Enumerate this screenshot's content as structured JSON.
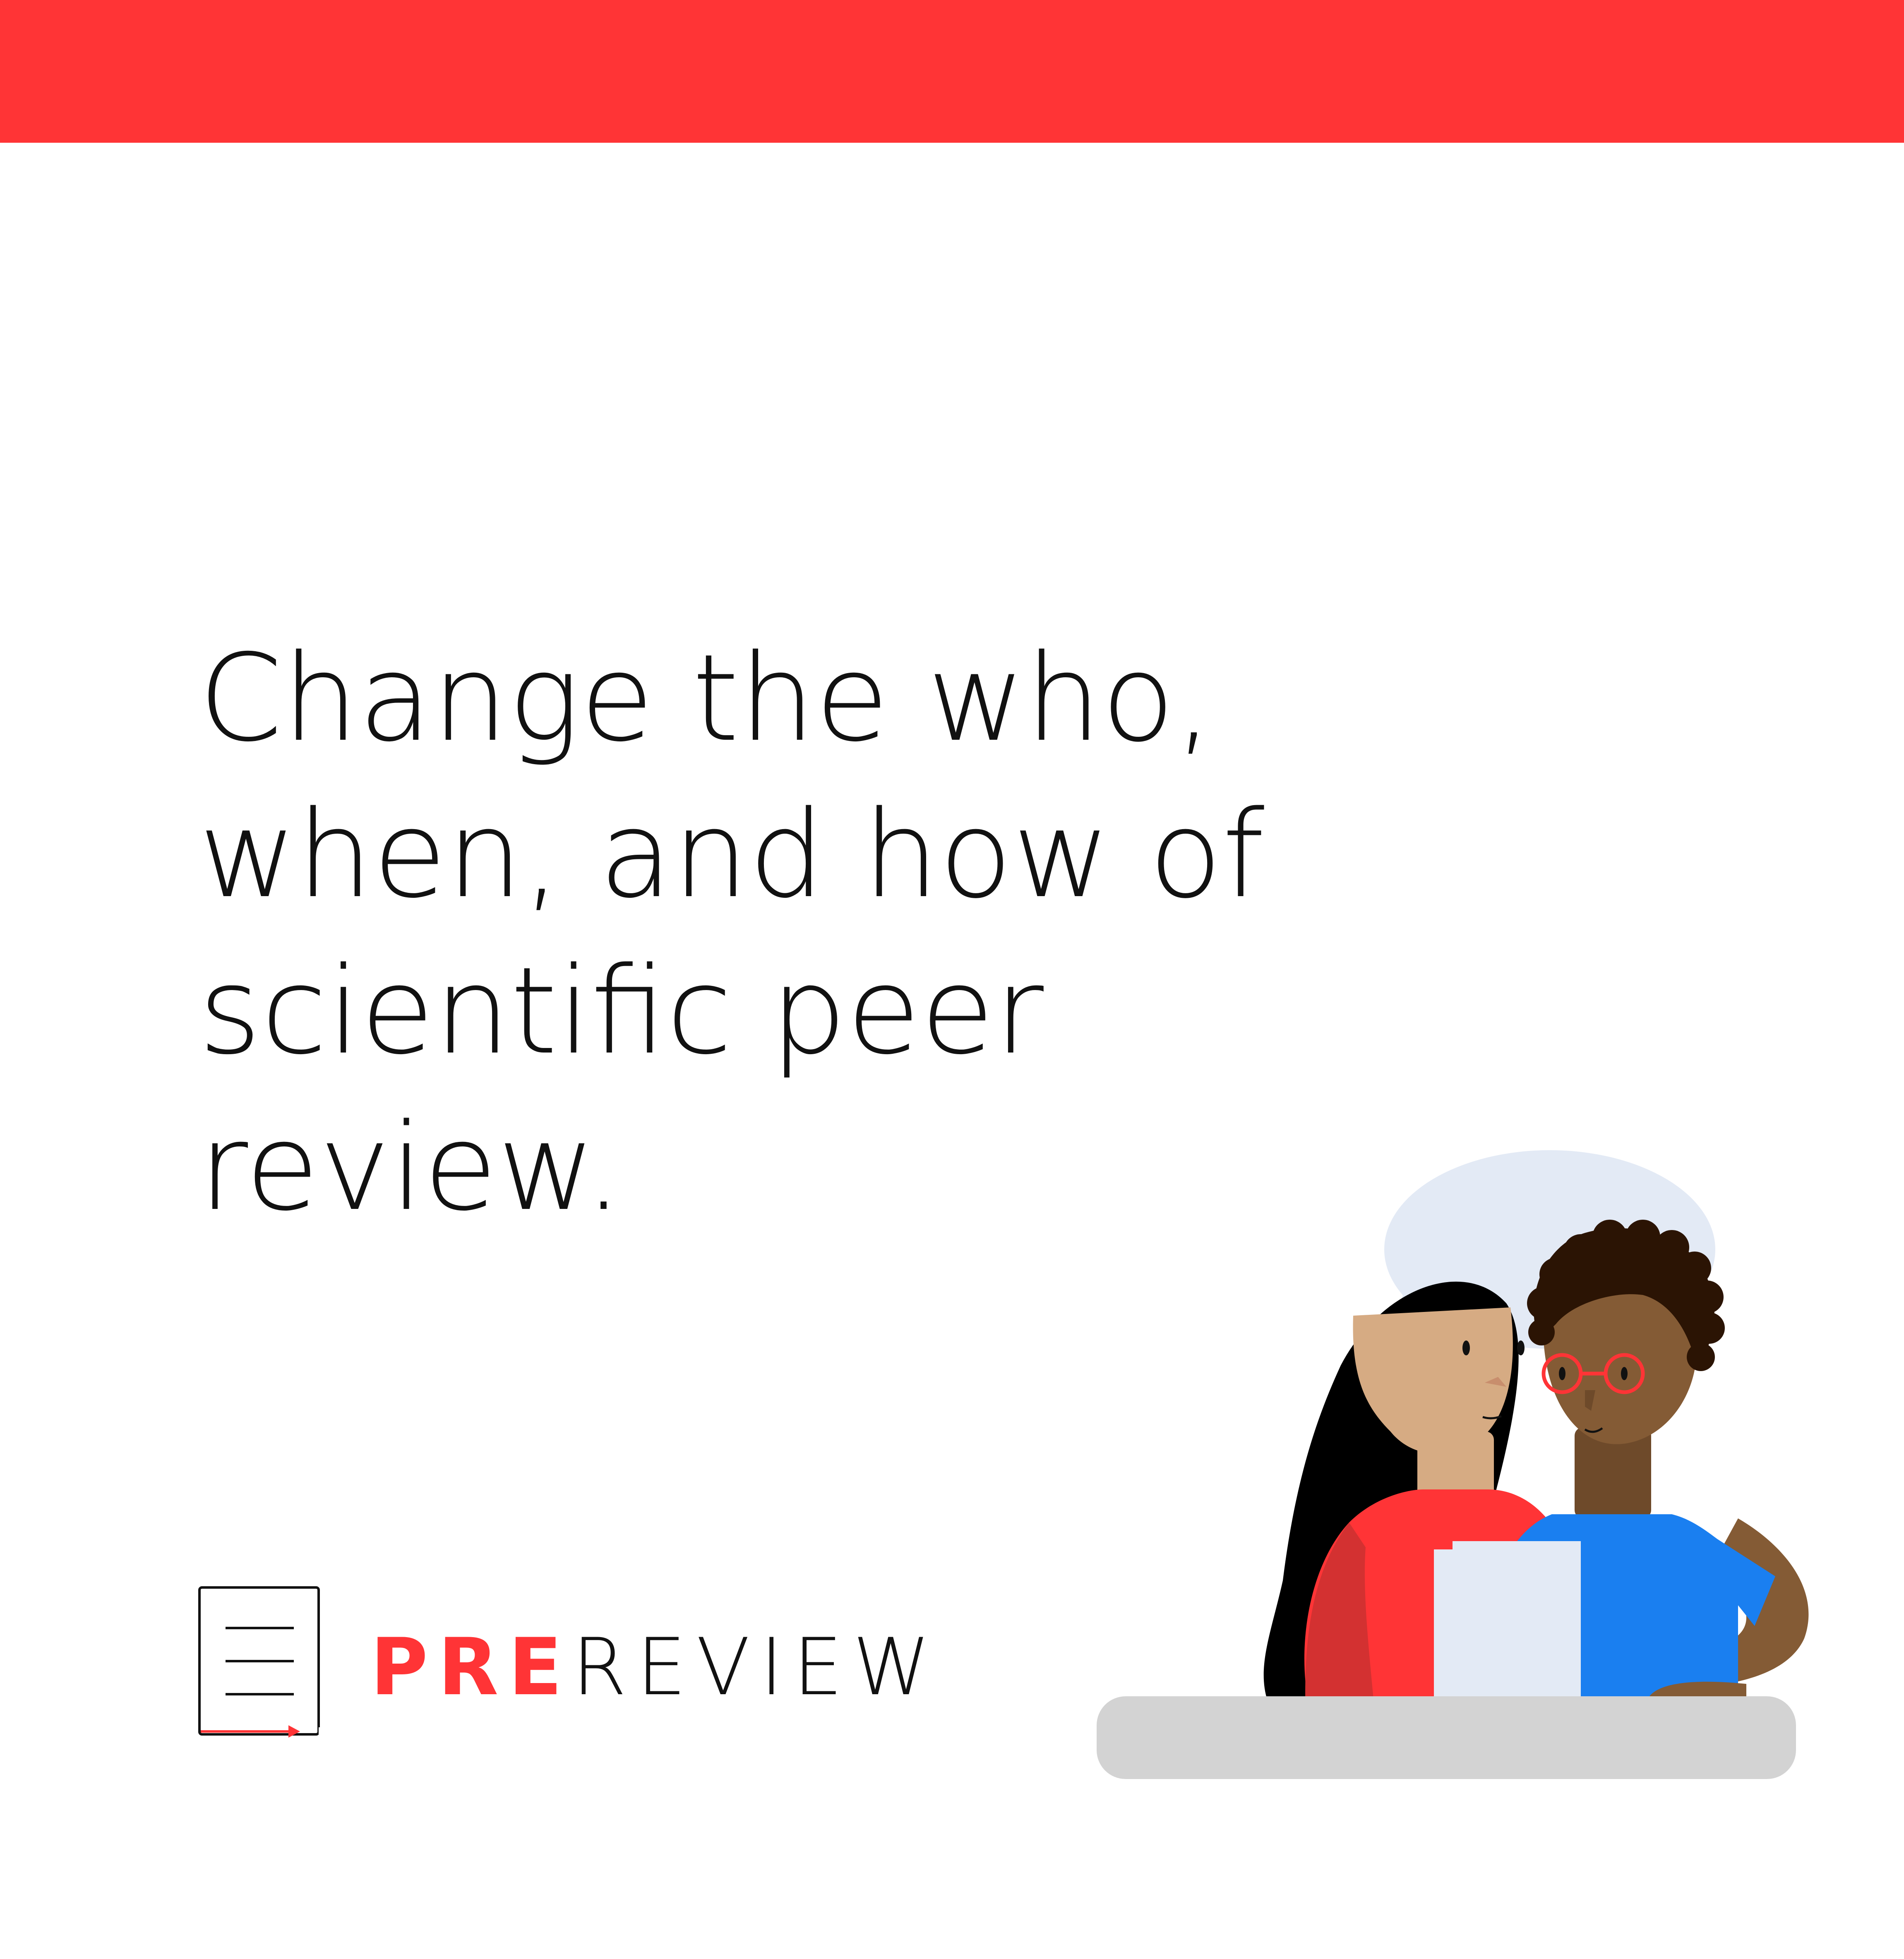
{
  "headline": {
    "line1": "Change the who,",
    "line2": "when, and how of",
    "line3": "scientific peer",
    "line4": "review."
  },
  "logo": {
    "pre": "PRE",
    "review": "REVIEW"
  },
  "colors": {
    "brand_red": "#ff3436",
    "text": "#111111",
    "background": "#ffffff",
    "speech_bubble": "#e3eaf5",
    "table": "#d3d3d3",
    "shirt_blue": "#1a7ff0"
  },
  "icons": {
    "logo_mark": "document-with-arrow-icon"
  }
}
